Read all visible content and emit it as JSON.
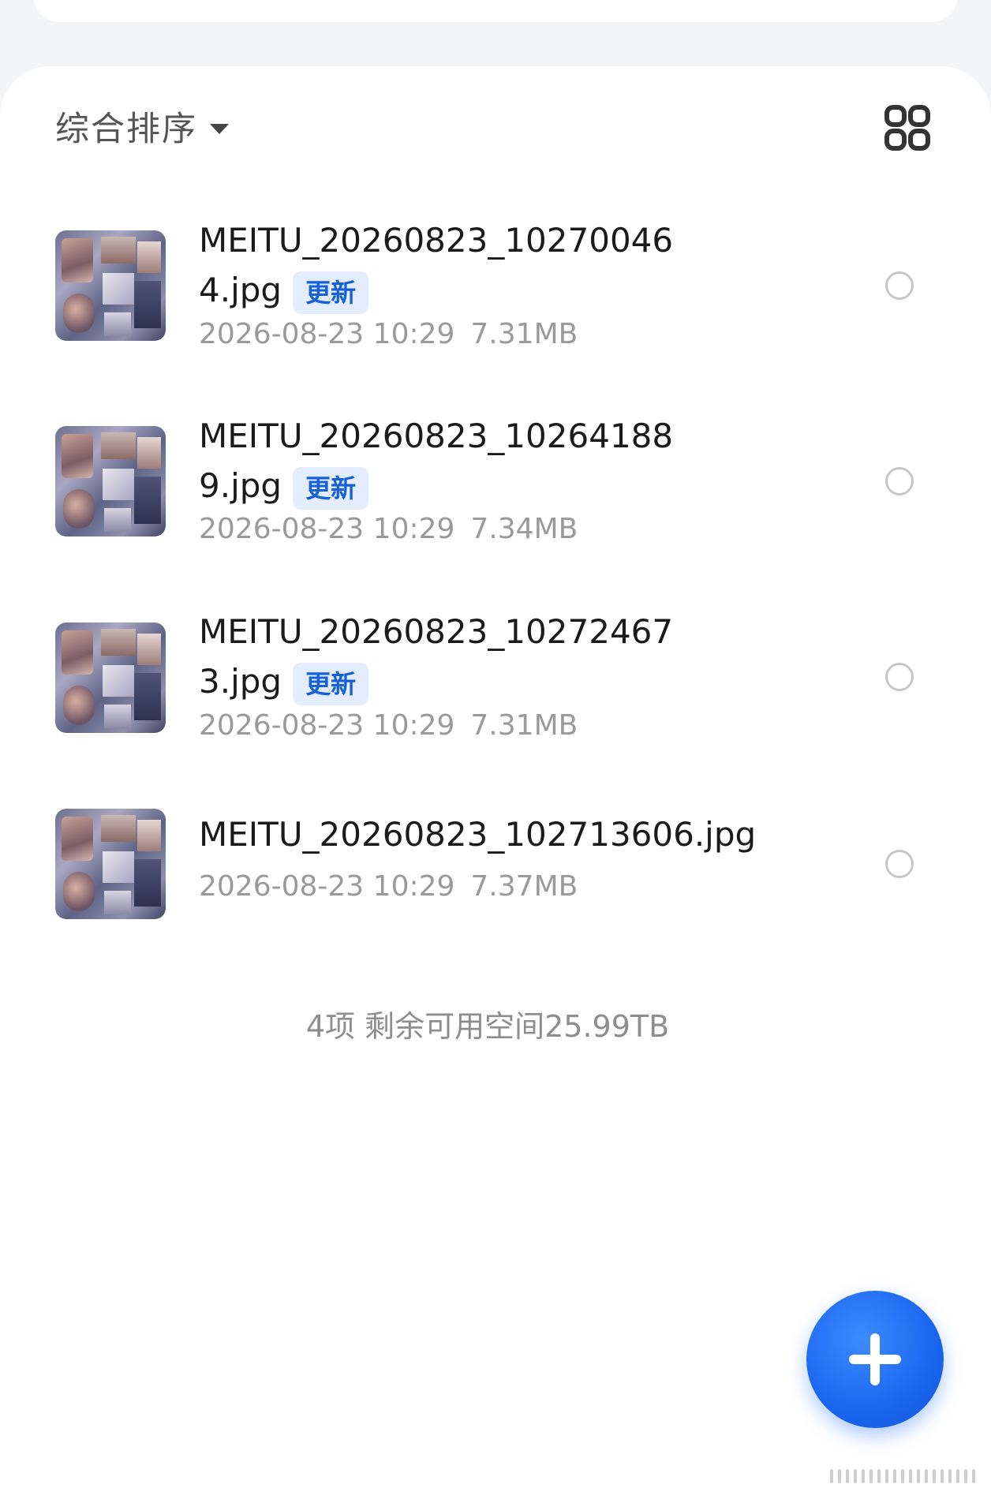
{
  "sort": {
    "label": "综合排序",
    "icon": "caret-down-icon"
  },
  "view_toggle": {
    "icon": "grid-view-icon"
  },
  "files": [
    {
      "name_line1": "MEITU_20260823_10270046",
      "name_line2": "4.jpg",
      "badge": "更新",
      "date": "2026-08-23 10:29",
      "size": "7.31MB"
    },
    {
      "name_line1": "MEITU_20260823_10264188",
      "name_line2": "9.jpg",
      "badge": "更新",
      "date": "2026-08-23 10:29",
      "size": "7.34MB"
    },
    {
      "name_line1": "MEITU_20260823_10272467",
      "name_line2": "3.jpg",
      "badge": "更新",
      "date": "2026-08-23 10:29",
      "size": "7.31MB"
    },
    {
      "name_line1": "MEITU_20260823_102713606.jpg",
      "date": "2026-08-23 10:29",
      "size": "7.37MB"
    }
  ],
  "summary": "4项 剩余可用空间25.99TB",
  "fab": {
    "icon": "plus-icon"
  },
  "colors": {
    "accent": "#1a66f0",
    "badge_bg": "#e3edfd",
    "badge_text": "#1660d8",
    "meta_text": "#9a9a9a"
  }
}
